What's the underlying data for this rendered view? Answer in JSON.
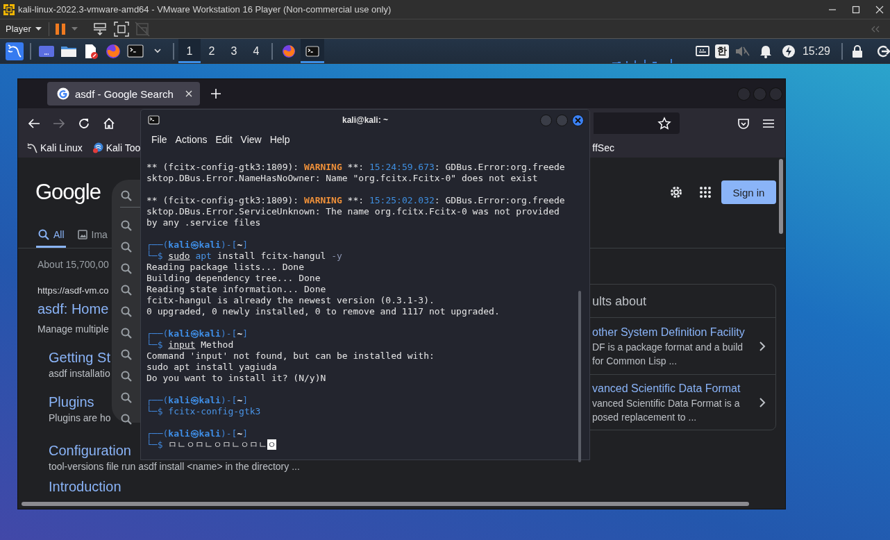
{
  "vmware": {
    "title": "kali-linux-2022.3-vmware-amd64 - VMware Workstation 16 Player (Non-commercial use only)",
    "menu": "Player"
  },
  "panel": {
    "workspaces": [
      {
        "label": "1",
        "selected": true
      },
      {
        "label": "2",
        "selected": false
      },
      {
        "label": "3",
        "selected": false
      },
      {
        "label": "4",
        "selected": false
      }
    ],
    "tasks": [
      {
        "kind": "browser",
        "selected": false
      },
      {
        "kind": "terminal",
        "selected": true
      }
    ],
    "input_method": "한",
    "clock": "15:29"
  },
  "browser": {
    "tab": {
      "title": "asdf - Google Search"
    },
    "bookmarks": [
      {
        "kind": "kali",
        "label": "Kali Linux"
      },
      {
        "kind": "tools",
        "label": "Kali Too"
      }
    ],
    "bookmark_right": "ffSec",
    "google": {
      "logo": "Google",
      "sign_in": "Sign in",
      "tabs": [
        {
          "kind": "all",
          "label": "All",
          "selected": true
        },
        {
          "kind": "images",
          "label": "Ima",
          "selected": false
        }
      ],
      "result_count": "About 15,700,00",
      "result": {
        "url": "https://asdf-vm.co",
        "title": "asdf: Home",
        "snippet": "Manage multiple",
        "sitelinks": [
          {
            "title": "Getting St",
            "snippet": "asdf installatio"
          },
          {
            "title": "Plugins",
            "snippet": "Plugins are ho"
          },
          {
            "title": "Configuration",
            "snippet": "tool-versions file run asdf install <name> in the directory ..."
          },
          {
            "title": "Introduction"
          }
        ]
      },
      "side_panel": {
        "heading": "ults about",
        "entries": [
          {
            "title": "other System Definition Facility",
            "snippet_lines": [
              "DF is a package format and a build",
              "for Common Lisp ..."
            ]
          },
          {
            "title": "vanced Scientific Data Format",
            "snippet_lines": [
              "vanced Scientific Data Format is a",
              "posed replacement to ..."
            ]
          }
        ]
      }
    }
  },
  "terminal": {
    "title": "kali@kali: ~",
    "menu": [
      "File",
      "Actions",
      "Edit",
      "View",
      "Help"
    ],
    "lines": [
      {
        "kind": "text",
        "segments": [
          {
            "kind": "plain",
            "text": "** (fcitx-config-gtk3:1809): "
          },
          {
            "kind": "warning",
            "text": "WARNING"
          },
          {
            "kind": "plain",
            "text": " **: "
          },
          {
            "kind": "time",
            "text": "15:24:59.673"
          },
          {
            "kind": "plain",
            "text": ": GDBus.Error:org.freede"
          }
        ]
      },
      {
        "kind": "text",
        "segments": [
          {
            "kind": "plain",
            "text": "sktop.DBus.Error.NameHasNoOwner: Name \"org.fcitx.Fcitx-0\" does not exist"
          }
        ]
      },
      {
        "kind": "blank"
      },
      {
        "kind": "text",
        "segments": [
          {
            "kind": "plain",
            "text": "** (fcitx-config-gtk3:1809): "
          },
          {
            "kind": "warning",
            "text": "WARNING"
          },
          {
            "kind": "plain",
            "text": " **: "
          },
          {
            "kind": "time",
            "text": "15:25:02.032"
          },
          {
            "kind": "plain",
            "text": ": GDBus.Error:org.freede"
          }
        ]
      },
      {
        "kind": "text",
        "segments": [
          {
            "kind": "plain",
            "text": "sktop.DBus.Error.ServiceUnknown: The name org.fcitx.Fcitx-0 was not provided"
          }
        ]
      },
      {
        "kind": "text",
        "segments": [
          {
            "kind": "plain",
            "text": "by any .service files"
          }
        ]
      },
      {
        "kind": "blank"
      },
      {
        "kind": "text",
        "segments": [
          {
            "kind": "frame",
            "text": "┌──("
          },
          {
            "kind": "user",
            "text": "kali㉿kali"
          },
          {
            "kind": "frame",
            "text": ")-["
          },
          {
            "kind": "dir",
            "text": "~"
          },
          {
            "kind": "frame",
            "text": "]"
          }
        ]
      },
      {
        "kind": "text",
        "segments": [
          {
            "kind": "frame",
            "text": "└─$ "
          },
          {
            "kind": "underline",
            "text": "sudo"
          },
          {
            "kind": "command",
            "text": " apt"
          },
          {
            "kind": "plain",
            "text": " install fcitx-hangul"
          },
          {
            "kind": "option",
            "text": " -y"
          }
        ]
      },
      {
        "kind": "text",
        "segments": [
          {
            "kind": "plain",
            "text": "Reading package lists... Done"
          }
        ]
      },
      {
        "kind": "text",
        "segments": [
          {
            "kind": "plain",
            "text": "Building dependency tree... Done"
          }
        ]
      },
      {
        "kind": "text",
        "segments": [
          {
            "kind": "plain",
            "text": "Reading state information... Done"
          }
        ]
      },
      {
        "kind": "text",
        "segments": [
          {
            "kind": "plain",
            "text": "fcitx-hangul is already the newest version (0.3.1-3)."
          }
        ]
      },
      {
        "kind": "text",
        "segments": [
          {
            "kind": "plain",
            "text": "0 upgraded, 0 newly installed, 0 to remove and 1117 not upgraded."
          }
        ]
      },
      {
        "kind": "blank"
      },
      {
        "kind": "text",
        "segments": [
          {
            "kind": "frame",
            "text": "┌──("
          },
          {
            "kind": "user",
            "text": "kali㉿kali"
          },
          {
            "kind": "frame",
            "text": ")-["
          },
          {
            "kind": "dir",
            "text": "~"
          },
          {
            "kind": "frame",
            "text": "]"
          }
        ]
      },
      {
        "kind": "text",
        "segments": [
          {
            "kind": "frame",
            "text": "└─$ "
          },
          {
            "kind": "underline",
            "text": "input"
          },
          {
            "kind": "plain",
            "text": " Method"
          }
        ]
      },
      {
        "kind": "text",
        "segments": [
          {
            "kind": "plain",
            "text": "Command 'input' not found, but can be installed with:"
          }
        ]
      },
      {
        "kind": "text",
        "segments": [
          {
            "kind": "plain",
            "text": "sudo apt install yagiuda"
          }
        ]
      },
      {
        "kind": "text",
        "segments": [
          {
            "kind": "plain",
            "text": "Do you want to install it? (N/y)N"
          }
        ]
      },
      {
        "kind": "blank"
      },
      {
        "kind": "text",
        "segments": [
          {
            "kind": "frame",
            "text": "┌──("
          },
          {
            "kind": "user",
            "text": "kali㉿kali"
          },
          {
            "kind": "frame",
            "text": ")-["
          },
          {
            "kind": "dir",
            "text": "~"
          },
          {
            "kind": "frame",
            "text": "]"
          }
        ]
      },
      {
        "kind": "text",
        "segments": [
          {
            "kind": "frame",
            "text": "└─$ "
          },
          {
            "kind": "command",
            "text": "fcitx-config-gtk3"
          }
        ]
      },
      {
        "kind": "blank"
      },
      {
        "kind": "text",
        "segments": [
          {
            "kind": "frame",
            "text": "┌──("
          },
          {
            "kind": "user",
            "text": "kali㉿kali"
          },
          {
            "kind": "frame",
            "text": ")-["
          },
          {
            "kind": "dir",
            "text": "~"
          },
          {
            "kind": "frame",
            "text": "]"
          }
        ]
      },
      {
        "kind": "text",
        "segments": [
          {
            "kind": "frame",
            "text": "└─$ "
          },
          {
            "kind": "plain",
            "text": "ㅁㄴㅇㅁㄴㅇㅁㄴㅇㅁㄴ"
          },
          {
            "kind": "cursor",
            "text": "ㅇ"
          }
        ]
      }
    ]
  }
}
